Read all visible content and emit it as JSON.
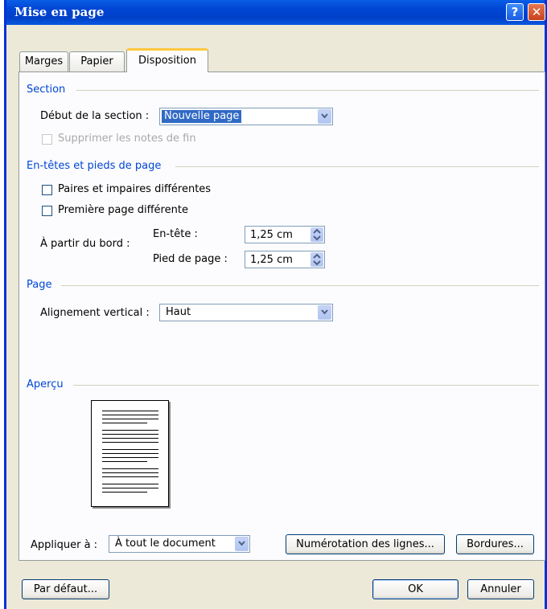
{
  "window": {
    "title": "Mise en page",
    "help_glyph": "?",
    "close_glyph": "✕"
  },
  "tabs": [
    {
      "label": "Marges",
      "active": false
    },
    {
      "label": "Papier",
      "active": false
    },
    {
      "label": "Disposition",
      "active": true
    }
  ],
  "section": {
    "group_label": "Section",
    "start_label": "Début de la section :",
    "start_value": "Nouvelle page",
    "suppress_endnotes_label": "Supprimer les notes de fin",
    "suppress_endnotes_checked": false
  },
  "headers_footers": {
    "group_label": "En-têtes et pieds de page",
    "odd_even_label": "Paires et impaires différentes",
    "odd_even_checked": false,
    "first_page_label": "Première page différente",
    "first_page_checked": false,
    "from_edge_label": "À partir du bord :",
    "header_label": "En-tête :",
    "header_value": "1,25 cm",
    "footer_label": "Pied de page :",
    "footer_value": "1,25 cm"
  },
  "page": {
    "group_label": "Page",
    "vertical_alignment_label": "Alignement vertical :",
    "vertical_alignment_value": "Haut"
  },
  "preview": {
    "group_label": "Aperçu"
  },
  "apply": {
    "label": "Appliquer à :",
    "value": "À tout le document"
  },
  "buttons": {
    "line_numbers": "Numérotation des lignes...",
    "borders": "Bordures...",
    "default": "Par défaut...",
    "ok": "OK",
    "cancel": "Annuler"
  },
  "colors": {
    "titlebar": "#0046d5",
    "group_label": "#0046d5",
    "dialog_bg": "#ece9d8",
    "selection": "#316ac5"
  }
}
